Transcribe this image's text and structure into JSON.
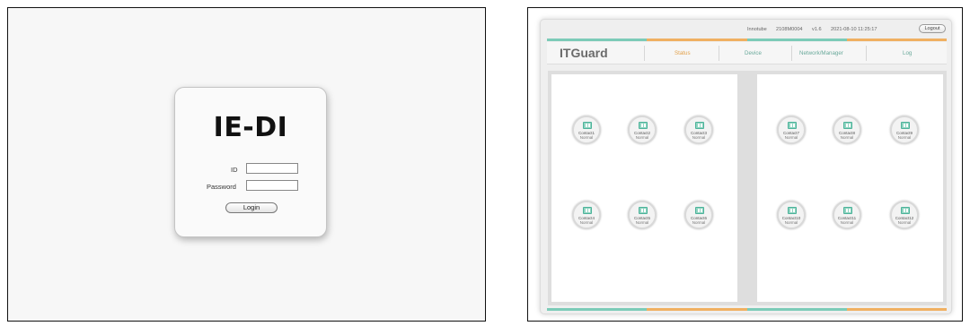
{
  "login": {
    "title": "IE-DI",
    "id_label": "ID",
    "password_label": "Password",
    "id_value": "",
    "password_value": "",
    "login_label": "Login"
  },
  "dashboard": {
    "topbar": {
      "company": "Innotube",
      "serial": "2108M0004",
      "version": "v1.6",
      "datetime": "2021-08-10 11:25:17",
      "logout_label": "Logout"
    },
    "brand": "ITGuard",
    "nav": [
      "Status",
      "Device",
      "Network/Manager",
      "Log"
    ],
    "active_nav": "Status",
    "colors": {
      "accent_teal": "#7ccbb8",
      "accent_orange": "#f0b062",
      "nav_text": "#6aa99b",
      "icon_fill": "#8fd4c1"
    },
    "contacts": [
      {
        "name": "Contact1",
        "status": "Normal"
      },
      {
        "name": "Contact2",
        "status": "Normal"
      },
      {
        "name": "Contact3",
        "status": "Normal"
      },
      {
        "name": "Contact4",
        "status": "Normal"
      },
      {
        "name": "Contact5",
        "status": "Normal"
      },
      {
        "name": "Contact6",
        "status": "Normal"
      },
      {
        "name": "Contact7",
        "status": "Normal"
      },
      {
        "name": "Contact8",
        "status": "Normal"
      },
      {
        "name": "Contact9",
        "status": "Normal"
      },
      {
        "name": "Contact10",
        "status": "Normal"
      },
      {
        "name": "Contact11",
        "status": "Normal"
      },
      {
        "name": "Contact12",
        "status": "Normal"
      }
    ]
  }
}
